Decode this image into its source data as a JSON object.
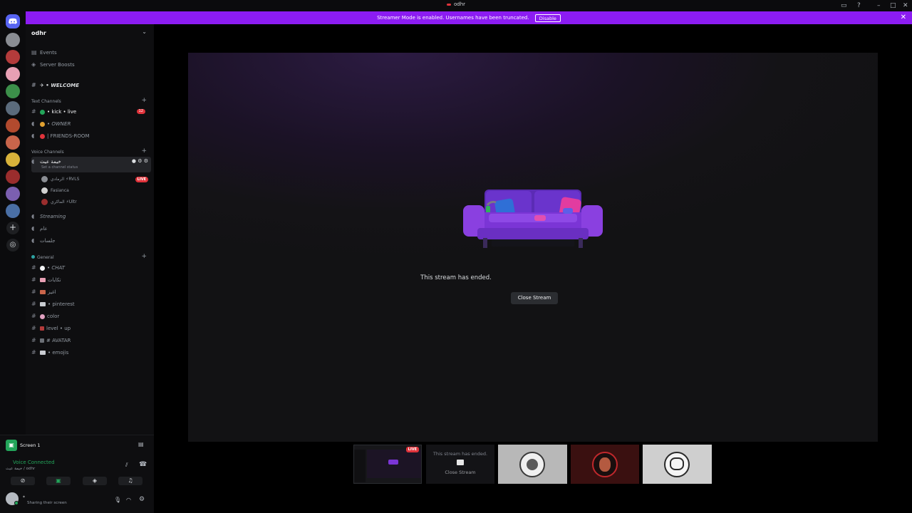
{
  "window": {
    "title": "odhr"
  },
  "banner": {
    "message": "Streamer Mode is enabled. Usernames have been truncated.",
    "disable_label": "Disable"
  },
  "server": {
    "name": "odhr",
    "top_items": [
      "Events",
      "Server Boosts"
    ],
    "welcome_channel": "✈ • WELCOME"
  },
  "categories": {
    "text": "Text Channels",
    "voice": "Voice Channels",
    "general": "General"
  },
  "text_channels": [
    {
      "label": "• kick • live",
      "badge": "12"
    },
    {
      "label": "• OWNER"
    },
    {
      "label": "| FRIENDS-ROOM"
    }
  ],
  "voice_channels": {
    "active": {
      "name": "خيمة عيث",
      "status": "Set a channel status",
      "users": [
        {
          "name": "الرمادي ⚡RVLS",
          "live": "LIVE"
        },
        {
          "name": "Fasianca"
        },
        {
          "name": "الماكري ⚡Ultr"
        }
      ]
    },
    "others": [
      "Streaming",
      "عام",
      "جلسات"
    ]
  },
  "general_channels": [
    "• CHAT",
    "تكايات",
    "اغيز",
    "• pinterest",
    "color",
    "level • up",
    "# AVATAR",
    "• emojis"
  ],
  "user_panel": {
    "screen_label": "Screen 1",
    "voice_status": "Voice Connected",
    "voice_location": "خيمة عيث / odhr",
    "sharing_status": "Sharing their screen"
  },
  "stream": {
    "ended_text": "This stream has ended.",
    "close_label": "Close Stream"
  },
  "thumbnails": {
    "live_label": "LIVE",
    "ended_text": "This stream has ended.",
    "close_label": "Close Stream"
  },
  "colors": {
    "banner": "#8c1cf2",
    "live": "#e0333b",
    "voice_green": "#23a55a",
    "couch": "#7b35d6"
  }
}
